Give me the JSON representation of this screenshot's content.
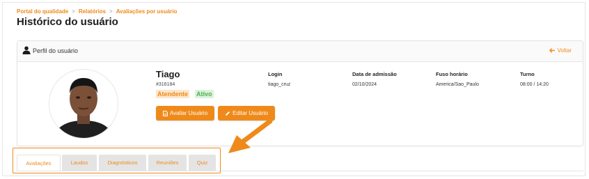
{
  "breadcrumb": [
    "Portal do qualidade",
    "Relatórios",
    "Avaliações por usuário"
  ],
  "page_title": "Histórico do usuário",
  "card": {
    "title": "Perfil do usuário",
    "back_label": "Voltar"
  },
  "user": {
    "name": "Tiago",
    "id": "#316184",
    "role": "Atendente",
    "status": "Ativo"
  },
  "buttons": {
    "avaliar": "Avaliar Usuário",
    "editar": "Editar Usuário"
  },
  "info": {
    "login_label": "Login",
    "login_value": "tiago_cruz",
    "admissao_label": "Data de admissão",
    "admissao_value": "02/10/2024",
    "fuso_label": "Fuso horário",
    "fuso_value": "America/Sao_Paulo",
    "turno_label": "Turno",
    "turno_value": "08:00 / 14:20"
  },
  "tabs": [
    "Avaliações",
    "Laudos",
    "Diagnósticos",
    "Reuniões",
    "Quiz"
  ],
  "active_tab": "Avaliações",
  "colors": {
    "accent": "#ef8a1a",
    "status_green": "#4caf50"
  },
  "icons": [
    "user-icon",
    "arrow-left-icon",
    "document-icon",
    "pencil-icon",
    "pointer-arrow-icon"
  ]
}
